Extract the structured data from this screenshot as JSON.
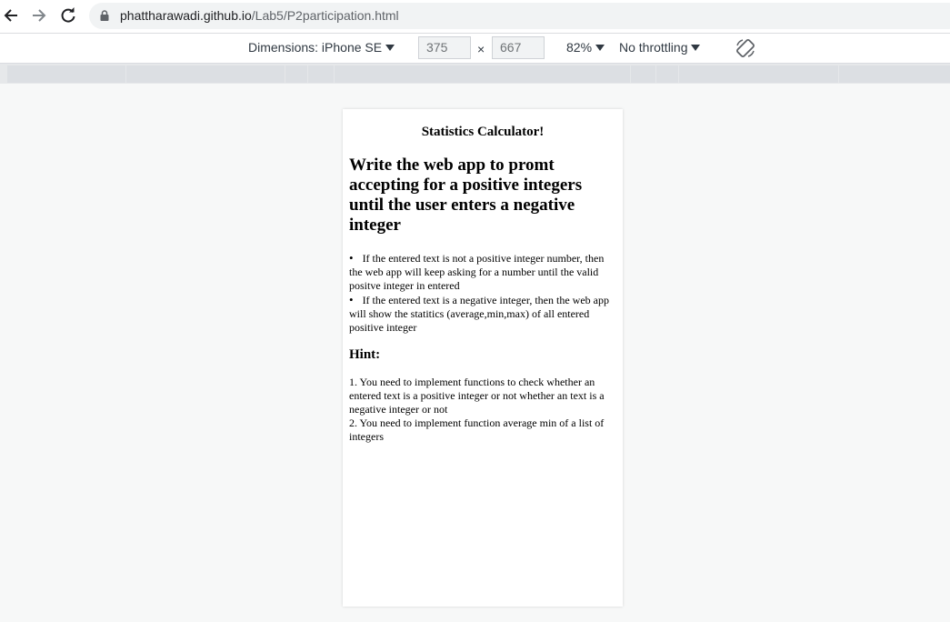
{
  "browser": {
    "url_host": "phattharawadi.github.io",
    "url_path": "/Lab5/P2participation.html"
  },
  "device_toolbar": {
    "dimensions_label": "Dimensions: iPhone SE",
    "width": "375",
    "height": "667",
    "times": "×",
    "zoom": "82%",
    "throttling": "No throttling"
  },
  "page": {
    "title": "Statistics Calculator!",
    "heading": "Write the web app to promt accepting for a positive integers until the user enters a negative integer",
    "bullets": [
      "If the entered text is not a positive integer number, then the web app will keep asking for a number until the valid positve integer in entered",
      "If the entered text is a negative integer, then the web app will show the statitics (average,min,max) of all entered positive integer"
    ],
    "hint_title": "Hint:",
    "hints": [
      "1. You need to implement functions to check whether an entered text is a positive integer or not whether an text is a negative integer or not",
      "2. You need to implement function average min of a list of integers"
    ]
  }
}
